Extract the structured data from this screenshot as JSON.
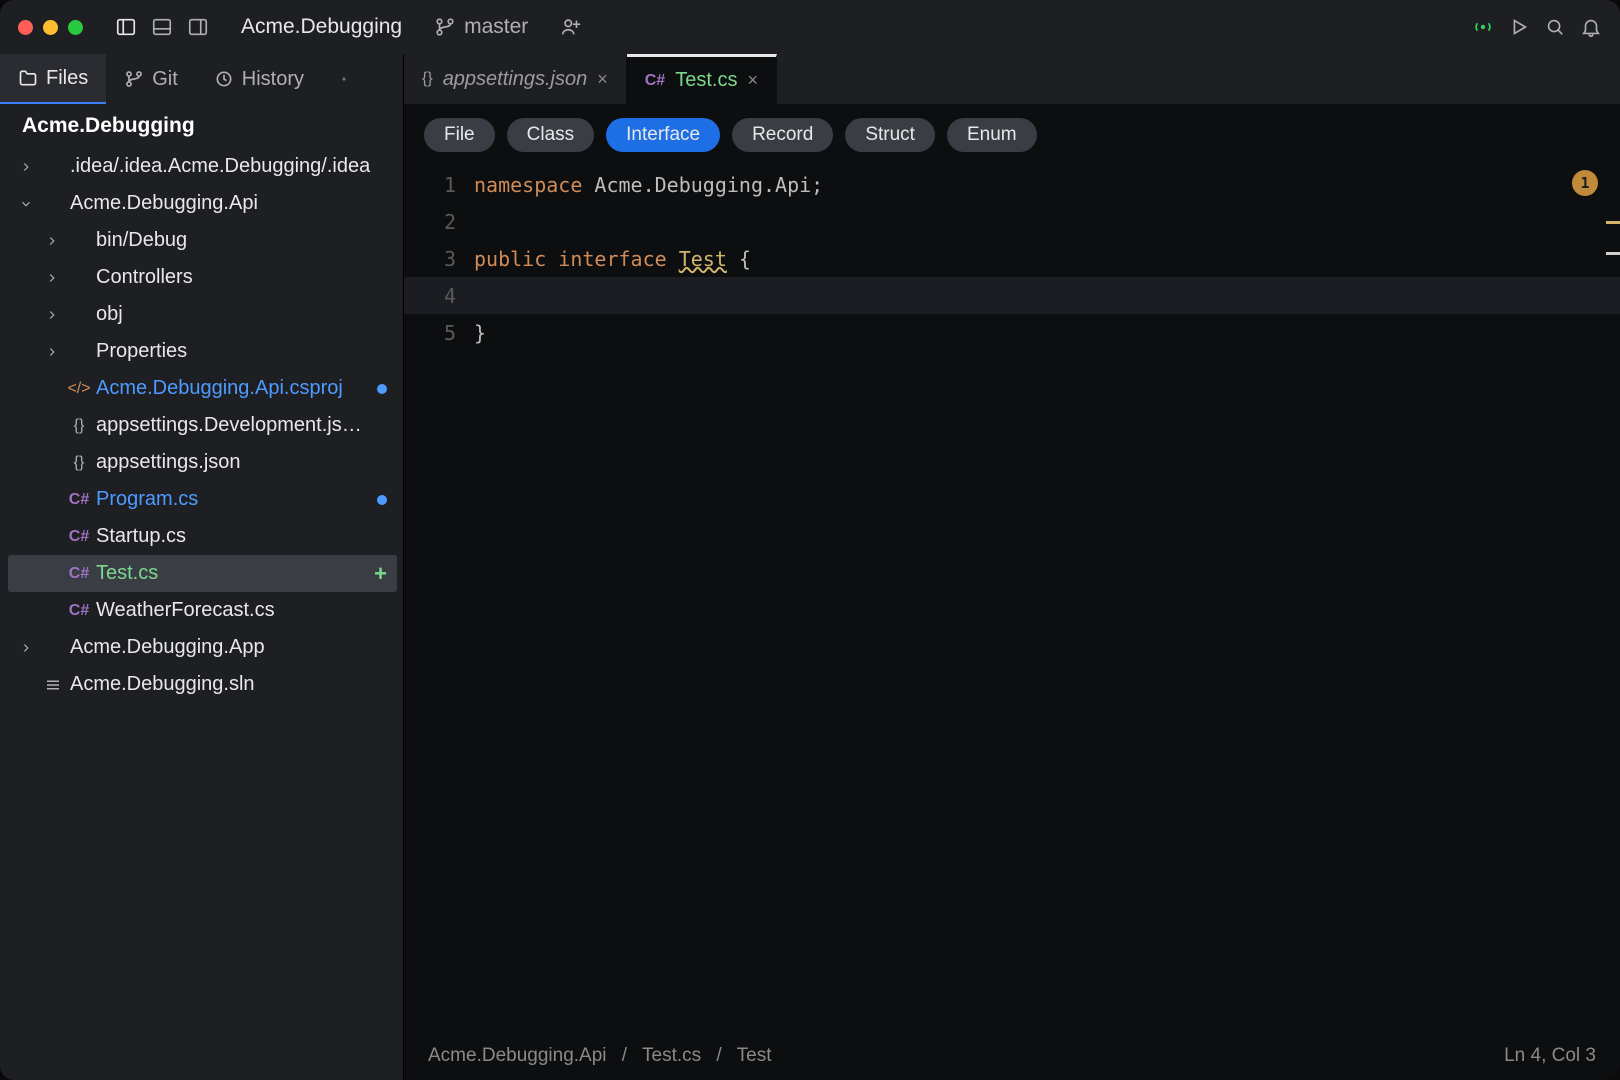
{
  "titlebar": {
    "project": "Acme.Debugging",
    "branch": "master"
  },
  "sidebar": {
    "tabs": {
      "files": "Files",
      "git": "Git",
      "history": "History"
    },
    "root": "Acme.Debugging",
    "nodes": [
      {
        "depth": 1,
        "arrow": "right",
        "icon": "folder",
        "label": ".idea/.idea.Acme.Debugging/.idea"
      },
      {
        "depth": 1,
        "arrow": "down",
        "icon": "folder",
        "label": "Acme.Debugging.Api"
      },
      {
        "depth": 2,
        "arrow": "right",
        "icon": "folder",
        "label": "bin/Debug"
      },
      {
        "depth": 2,
        "arrow": "right",
        "icon": "folder",
        "label": "Controllers"
      },
      {
        "depth": 2,
        "arrow": "right",
        "icon": "folder",
        "label": "obj"
      },
      {
        "depth": 2,
        "arrow": "right",
        "icon": "folder",
        "label": "Properties"
      },
      {
        "depth": 2,
        "arrow": "",
        "icon": "csproj",
        "label": "Acme.Debugging.Api.csproj",
        "modified": true,
        "status": "dot"
      },
      {
        "depth": 2,
        "arrow": "",
        "icon": "json",
        "label": "appsettings.Development.js…"
      },
      {
        "depth": 2,
        "arrow": "",
        "icon": "json",
        "label": "appsettings.json"
      },
      {
        "depth": 2,
        "arrow": "",
        "icon": "cs",
        "label": "Program.cs",
        "modified": true,
        "status": "dot"
      },
      {
        "depth": 2,
        "arrow": "",
        "icon": "cs",
        "label": "Startup.cs"
      },
      {
        "depth": 2,
        "arrow": "",
        "icon": "cs",
        "label": "Test.cs",
        "selected": true,
        "status": "plus"
      },
      {
        "depth": 2,
        "arrow": "",
        "icon": "cs",
        "label": "WeatherForecast.cs"
      },
      {
        "depth": 1,
        "arrow": "right",
        "icon": "folder",
        "label": "Acme.Debugging.App"
      },
      {
        "depth": 1,
        "arrow": "",
        "icon": "sln",
        "label": "Acme.Debugging.sln"
      }
    ]
  },
  "editor": {
    "tabs": [
      {
        "icon": "json",
        "name": "appsettings.json",
        "active": false
      },
      {
        "icon": "cs",
        "name": "Test.cs",
        "active": true
      }
    ],
    "chips": [
      "File",
      "Class",
      "Interface",
      "Record",
      "Struct",
      "Enum"
    ],
    "chip_active": 2,
    "code": {
      "l1a": "namespace",
      "l1b": " Acme.Debugging.Api;",
      "l3a": "public",
      "l3b": "interface",
      "l3c": "Test",
      "l3d": " {",
      "l5a": "}"
    },
    "badge": "1",
    "breadcrumb": {
      "a": "Acme.Debugging.Api",
      "b": "Test.cs",
      "c": "Test"
    },
    "caret": "Ln 4, Col 3"
  }
}
